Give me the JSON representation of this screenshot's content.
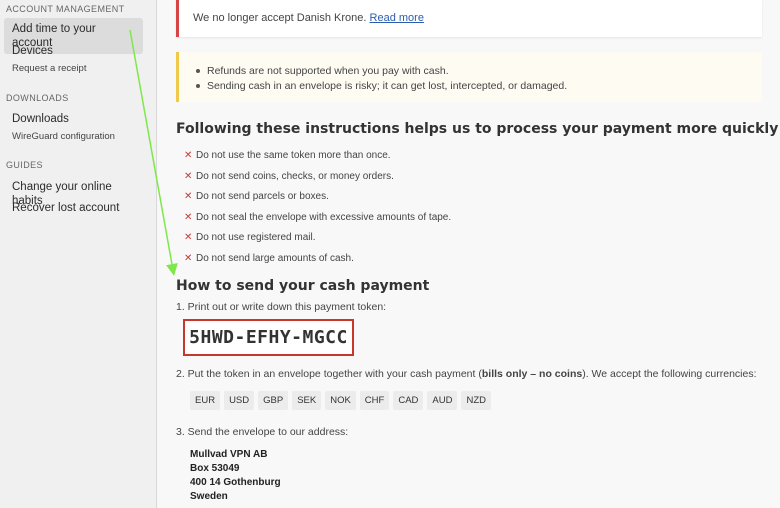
{
  "sidebar": {
    "sections": [
      {
        "heading": "ACCOUNT MANAGEMENT",
        "items": [
          "Add time to your account",
          "Devices"
        ],
        "sub": [
          "Request a receipt"
        ]
      },
      {
        "heading": "DOWNLOADS",
        "items": [
          "Downloads"
        ],
        "sub": [
          "WireGuard configuration"
        ]
      },
      {
        "heading": "GUIDES",
        "items": [
          "Change your online habits",
          "Recover lost account"
        ]
      }
    ],
    "active_item": "Add time to your account"
  },
  "alerts": {
    "danger_text": "We no longer accept Danish Krone.",
    "danger_link": "Read more",
    "warn_items": [
      "Refunds are not supported when you pay with cash.",
      "Sending cash in an envelope is risky; it can get lost, intercepted, or damaged."
    ]
  },
  "instructions": {
    "heading": "Following these instructions helps us to process your payment more quickly",
    "rules": [
      "Do not use the same token more than once.",
      "Do not send coins, checks, or money orders.",
      "Do not send parcels or boxes.",
      "Do not seal the envelope with excessive amounts of tape.",
      "Do not use registered mail.",
      "Do not send large amounts of cash."
    ]
  },
  "send": {
    "heading": "How to send your cash payment",
    "step1": "1. Print out or write down this payment token:",
    "token": "5HWD-EFHY-MGCC",
    "step2_pre": "2. Put the token in an envelope together with your cash payment (",
    "step2_bold": "bills only – no coins",
    "step2_post": "). We accept the following currencies:",
    "currencies": [
      "EUR",
      "USD",
      "GBP",
      "SEK",
      "NOK",
      "CHF",
      "CAD",
      "AUD",
      "NZD"
    ],
    "step3": "3. Send the envelope to our address:",
    "address": [
      "Mullvad VPN AB",
      "Box 53049",
      "400 14 Gothenburg",
      "Sweden"
    ]
  },
  "colors": {
    "danger": "#d64545",
    "warning": "#f0c94a",
    "token_border": "#c9362c",
    "arrow": "#7ee84a"
  }
}
